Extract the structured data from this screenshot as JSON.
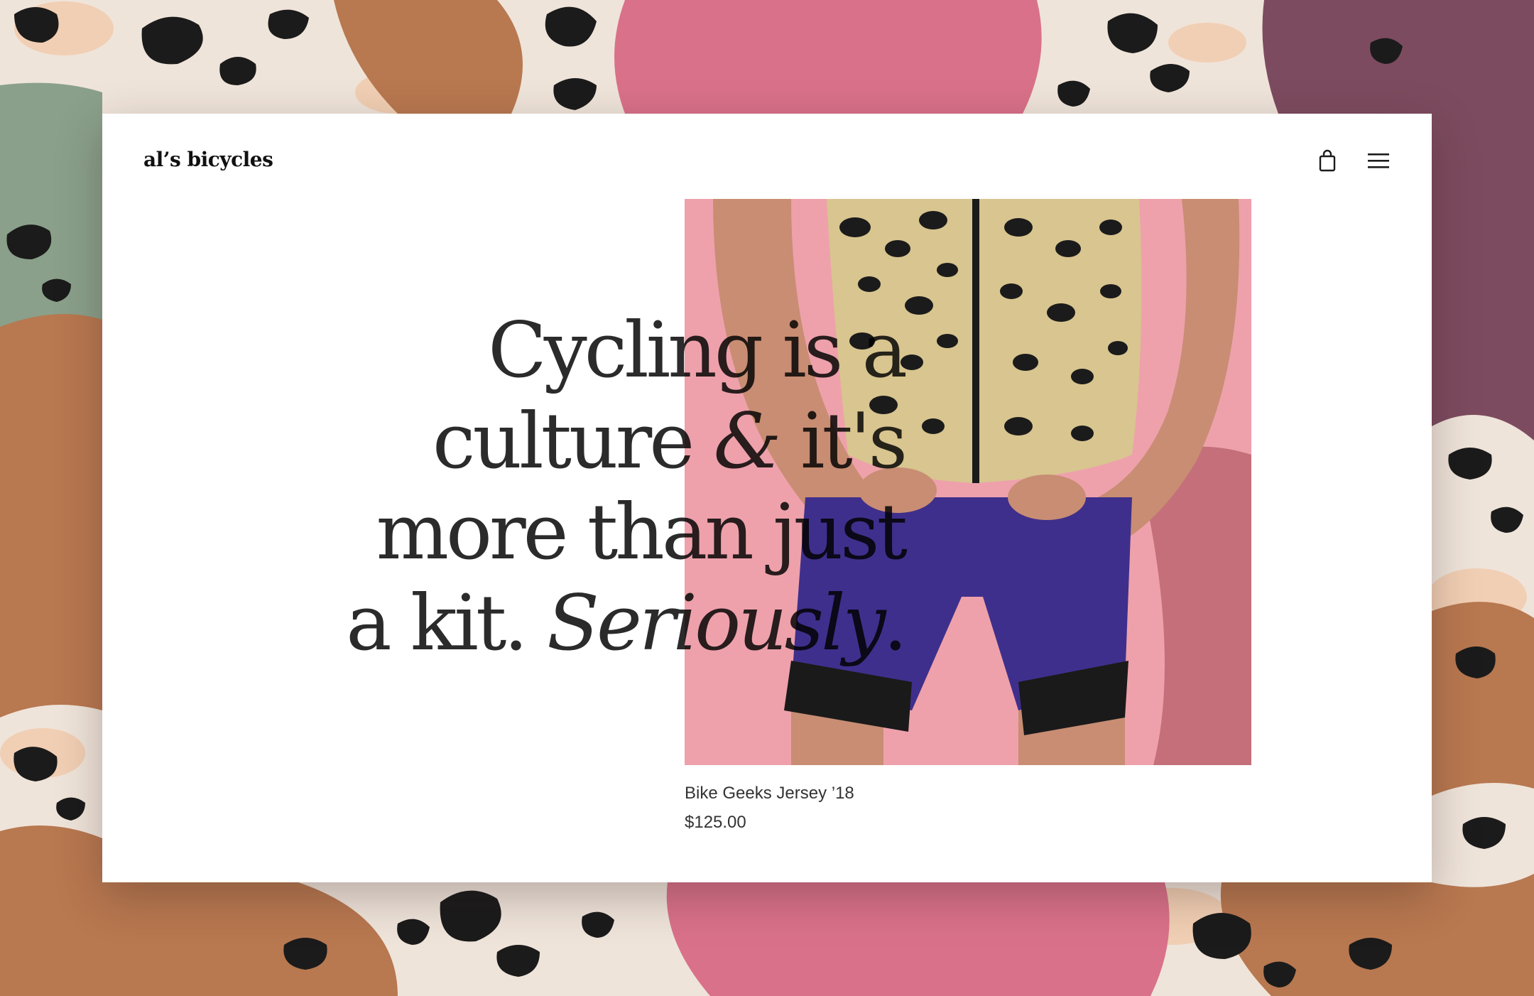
{
  "brand": {
    "logo_text": "al’s bicycles"
  },
  "header": {
    "cart_icon": "shopping-bag-icon",
    "menu_icon": "hamburger-menu-icon"
  },
  "hero": {
    "line1_part1": "Cycling ",
    "line1_part2": "is a",
    "line2_part1": "culture ",
    "line2_amp": "&",
    "line2_part2": " it's",
    "line3": "more than just",
    "line4_part1": "a kit. ",
    "line4_italic": "Seriously",
    "line4_end": "."
  },
  "product": {
    "name": "Bike Geeks Jersey ’18",
    "price": "$125.00"
  },
  "colors": {
    "page_background": "#efe4da",
    "card_background": "#ffffff",
    "text": "#2b2b2b",
    "image_background_pink": "#eea1ab",
    "shorts_purple": "#3f2f8c",
    "leopard_tan": "#d8c58f",
    "backdrop_brown": "#b87850",
    "backdrop_pink": "#d9718a",
    "backdrop_plum": "#7d4b5f",
    "backdrop_sage": "#8aa08a"
  }
}
